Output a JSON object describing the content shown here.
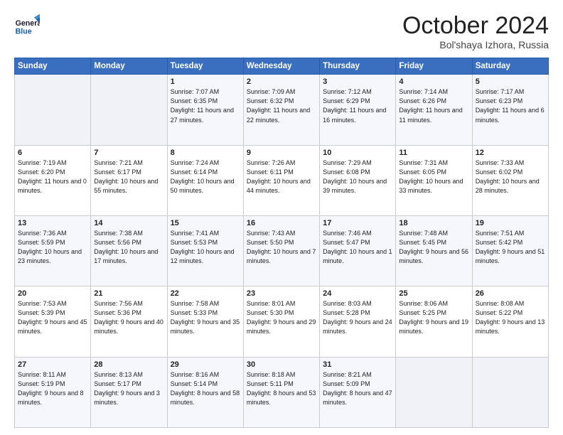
{
  "header": {
    "logo_line1": "General",
    "logo_line2": "Blue",
    "title": "October 2024",
    "subtitle": "Bol'shaya Izhora, Russia"
  },
  "days_of_week": [
    "Sunday",
    "Monday",
    "Tuesday",
    "Wednesday",
    "Thursday",
    "Friday",
    "Saturday"
  ],
  "weeks": [
    [
      {
        "day": "",
        "info": ""
      },
      {
        "day": "",
        "info": ""
      },
      {
        "day": "1",
        "info": "Sunrise: 7:07 AM\nSunset: 6:35 PM\nDaylight: 11 hours and 27 minutes."
      },
      {
        "day": "2",
        "info": "Sunrise: 7:09 AM\nSunset: 6:32 PM\nDaylight: 11 hours and 22 minutes."
      },
      {
        "day": "3",
        "info": "Sunrise: 7:12 AM\nSunset: 6:29 PM\nDaylight: 11 hours and 16 minutes."
      },
      {
        "day": "4",
        "info": "Sunrise: 7:14 AM\nSunset: 6:26 PM\nDaylight: 11 hours and 11 minutes."
      },
      {
        "day": "5",
        "info": "Sunrise: 7:17 AM\nSunset: 6:23 PM\nDaylight: 11 hours and 6 minutes."
      }
    ],
    [
      {
        "day": "6",
        "info": "Sunrise: 7:19 AM\nSunset: 6:20 PM\nDaylight: 11 hours and 0 minutes."
      },
      {
        "day": "7",
        "info": "Sunrise: 7:21 AM\nSunset: 6:17 PM\nDaylight: 10 hours and 55 minutes."
      },
      {
        "day": "8",
        "info": "Sunrise: 7:24 AM\nSunset: 6:14 PM\nDaylight: 10 hours and 50 minutes."
      },
      {
        "day": "9",
        "info": "Sunrise: 7:26 AM\nSunset: 6:11 PM\nDaylight: 10 hours and 44 minutes."
      },
      {
        "day": "10",
        "info": "Sunrise: 7:29 AM\nSunset: 6:08 PM\nDaylight: 10 hours and 39 minutes."
      },
      {
        "day": "11",
        "info": "Sunrise: 7:31 AM\nSunset: 6:05 PM\nDaylight: 10 hours and 33 minutes."
      },
      {
        "day": "12",
        "info": "Sunrise: 7:33 AM\nSunset: 6:02 PM\nDaylight: 10 hours and 28 minutes."
      }
    ],
    [
      {
        "day": "13",
        "info": "Sunrise: 7:36 AM\nSunset: 5:59 PM\nDaylight: 10 hours and 23 minutes."
      },
      {
        "day": "14",
        "info": "Sunrise: 7:38 AM\nSunset: 5:56 PM\nDaylight: 10 hours and 17 minutes."
      },
      {
        "day": "15",
        "info": "Sunrise: 7:41 AM\nSunset: 5:53 PM\nDaylight: 10 hours and 12 minutes."
      },
      {
        "day": "16",
        "info": "Sunrise: 7:43 AM\nSunset: 5:50 PM\nDaylight: 10 hours and 7 minutes."
      },
      {
        "day": "17",
        "info": "Sunrise: 7:46 AM\nSunset: 5:47 PM\nDaylight: 10 hours and 1 minute."
      },
      {
        "day": "18",
        "info": "Sunrise: 7:48 AM\nSunset: 5:45 PM\nDaylight: 9 hours and 56 minutes."
      },
      {
        "day": "19",
        "info": "Sunrise: 7:51 AM\nSunset: 5:42 PM\nDaylight: 9 hours and 51 minutes."
      }
    ],
    [
      {
        "day": "20",
        "info": "Sunrise: 7:53 AM\nSunset: 5:39 PM\nDaylight: 9 hours and 45 minutes."
      },
      {
        "day": "21",
        "info": "Sunrise: 7:56 AM\nSunset: 5:36 PM\nDaylight: 9 hours and 40 minutes."
      },
      {
        "day": "22",
        "info": "Sunrise: 7:58 AM\nSunset: 5:33 PM\nDaylight: 9 hours and 35 minutes."
      },
      {
        "day": "23",
        "info": "Sunrise: 8:01 AM\nSunset: 5:30 PM\nDaylight: 9 hours and 29 minutes."
      },
      {
        "day": "24",
        "info": "Sunrise: 8:03 AM\nSunset: 5:28 PM\nDaylight: 9 hours and 24 minutes."
      },
      {
        "day": "25",
        "info": "Sunrise: 8:06 AM\nSunset: 5:25 PM\nDaylight: 9 hours and 19 minutes."
      },
      {
        "day": "26",
        "info": "Sunrise: 8:08 AM\nSunset: 5:22 PM\nDaylight: 9 hours and 13 minutes."
      }
    ],
    [
      {
        "day": "27",
        "info": "Sunrise: 8:11 AM\nSunset: 5:19 PM\nDaylight: 9 hours and 8 minutes."
      },
      {
        "day": "28",
        "info": "Sunrise: 8:13 AM\nSunset: 5:17 PM\nDaylight: 9 hours and 3 minutes."
      },
      {
        "day": "29",
        "info": "Sunrise: 8:16 AM\nSunset: 5:14 PM\nDaylight: 8 hours and 58 minutes."
      },
      {
        "day": "30",
        "info": "Sunrise: 8:18 AM\nSunset: 5:11 PM\nDaylight: 8 hours and 53 minutes."
      },
      {
        "day": "31",
        "info": "Sunrise: 8:21 AM\nSunset: 5:09 PM\nDaylight: 8 hours and 47 minutes."
      },
      {
        "day": "",
        "info": ""
      },
      {
        "day": "",
        "info": ""
      }
    ]
  ]
}
